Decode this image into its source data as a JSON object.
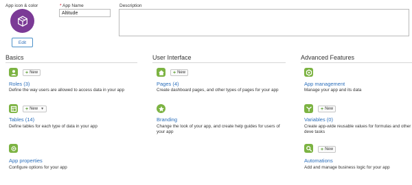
{
  "app_icon": {
    "label": "App icon & color",
    "edit_label": "Edit",
    "color": "#7b3a96"
  },
  "app_name": {
    "label": "App Name",
    "required_mark": "*",
    "value": "Altitude"
  },
  "description": {
    "label": "Description",
    "value": ""
  },
  "accent_color": "#7cb342",
  "link_color": "#2a6ebb",
  "sections": {
    "basics": {
      "title": "Basics",
      "roles": {
        "title": "Roles (3)",
        "new_label": "New",
        "desc": "Define the way users are allowed to access data in your app",
        "icon": "user-icon"
      },
      "tables": {
        "title": "Tables (14)",
        "new_label": "New",
        "desc": "Define tables for each type of data in your app",
        "icon": "table-icon"
      },
      "app_properties": {
        "title": "App properties",
        "desc": "Configure options for your app",
        "icon": "gear-icon"
      }
    },
    "user_interface": {
      "title": "User Interface",
      "pages": {
        "title": "Pages (4)",
        "new_label": "New",
        "desc": "Create dashboard pages, and other types of pages for your app",
        "icon": "home-icon"
      },
      "branding": {
        "title": "Branding",
        "desc": "Change the look of your app, and create help guides for users of your app",
        "icon": "star-icon"
      }
    },
    "advanced": {
      "title": "Advanced Features",
      "app_management": {
        "title": "App management",
        "desc": "Manage your app and its data",
        "icon": "hexagon-icon"
      },
      "variables": {
        "title": "Variables (0)",
        "new_label": "New",
        "desc": "Create app-wide reusable values for formulas and other deve tasks",
        "icon": "variable-icon"
      },
      "automations": {
        "title": "Automations",
        "new_label": "New",
        "desc": "Add and manage business logic for your app",
        "icon": "automation-icon"
      }
    }
  }
}
